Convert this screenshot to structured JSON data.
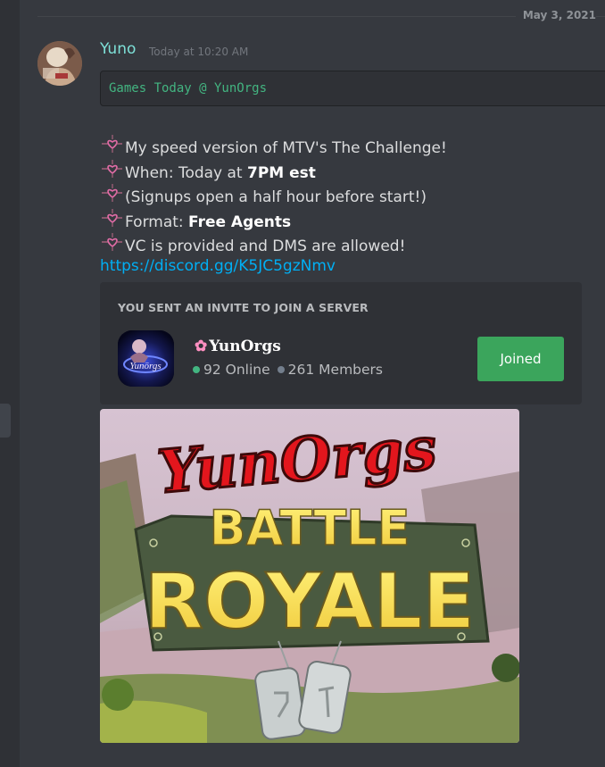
{
  "divider": {
    "date": "May 3, 2021"
  },
  "message": {
    "author": "Yuno",
    "timestamp": "Today at 10:20 AM",
    "code_block": "Games Today @ YunOrgs",
    "lines": [
      {
        "text": "My speed version of MTV's The Challenge!",
        "bold": ""
      },
      {
        "text": "When: Today at ",
        "bold": "7PM est"
      },
      {
        "text": "(Signups open a half hour before start!)",
        "bold": ""
      },
      {
        "text": "Format: ",
        "bold": "Free Agents"
      },
      {
        "text": "VC is provided and DMS are allowed!",
        "bold": ""
      }
    ],
    "link": "https://discord.gg/K5JC5gzNmv"
  },
  "invite": {
    "heading": "YOU SENT AN INVITE TO JOIN A SERVER",
    "server_name": "YunOrgs",
    "server_icon_text": "Yunörgs",
    "online": "92 Online",
    "members": "261 Members",
    "button_label": "Joined"
  },
  "image": {
    "title": "YunOrgs",
    "line1": "BATTLE",
    "line2": "ROYALE"
  },
  "colors": {
    "background": "#36393f",
    "username": "#7ee1d8",
    "link": "#00aff4",
    "button": "#3ba55c",
    "online_dot": "#43b581"
  }
}
